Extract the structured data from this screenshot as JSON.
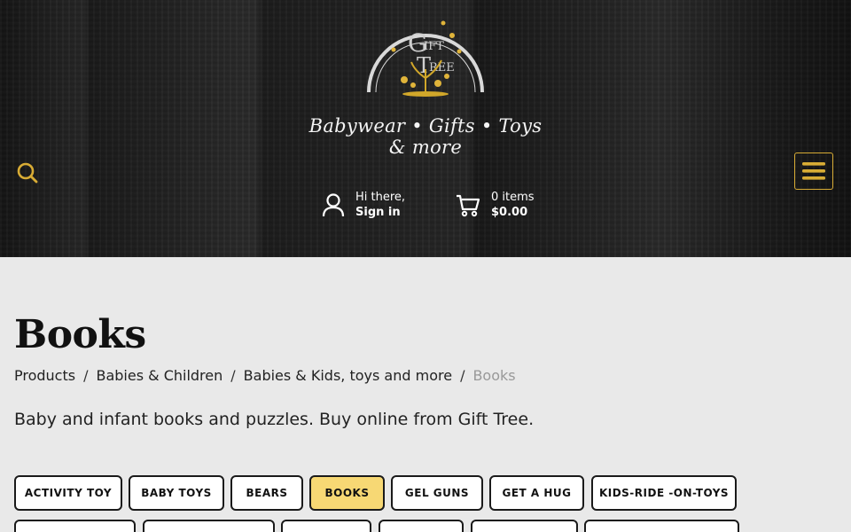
{
  "header": {
    "logo_text": "GIFT TREE",
    "tagline": "Babywear • Gifts • Toys & more",
    "account": {
      "greeting": "Hi there,",
      "action": "Sign in"
    },
    "cart": {
      "items": "0 items",
      "total": "$0.00"
    }
  },
  "page": {
    "title": "Books",
    "breadcrumb": [
      {
        "label": "Products"
      },
      {
        "label": "Babies & Children"
      },
      {
        "label": "Babies & Kids, toys and more"
      },
      {
        "label": "Books"
      }
    ],
    "description": "Baby and infant books and puzzles. Buy online from Gift Tree."
  },
  "tags": [
    {
      "label": "ACTIVITY TOY",
      "active": false
    },
    {
      "label": "BABY TOYS",
      "active": false
    },
    {
      "label": "BEARS",
      "active": false
    },
    {
      "label": "BOOKS",
      "active": true
    },
    {
      "label": "GEL GUNS",
      "active": false
    },
    {
      "label": "GET A HUG",
      "active": false
    },
    {
      "label": "KIDS-RIDE -ON-TOYS",
      "active": false
    }
  ],
  "colors": {
    "accent": "#d8ac35",
    "active_tag": "#f7d874"
  }
}
